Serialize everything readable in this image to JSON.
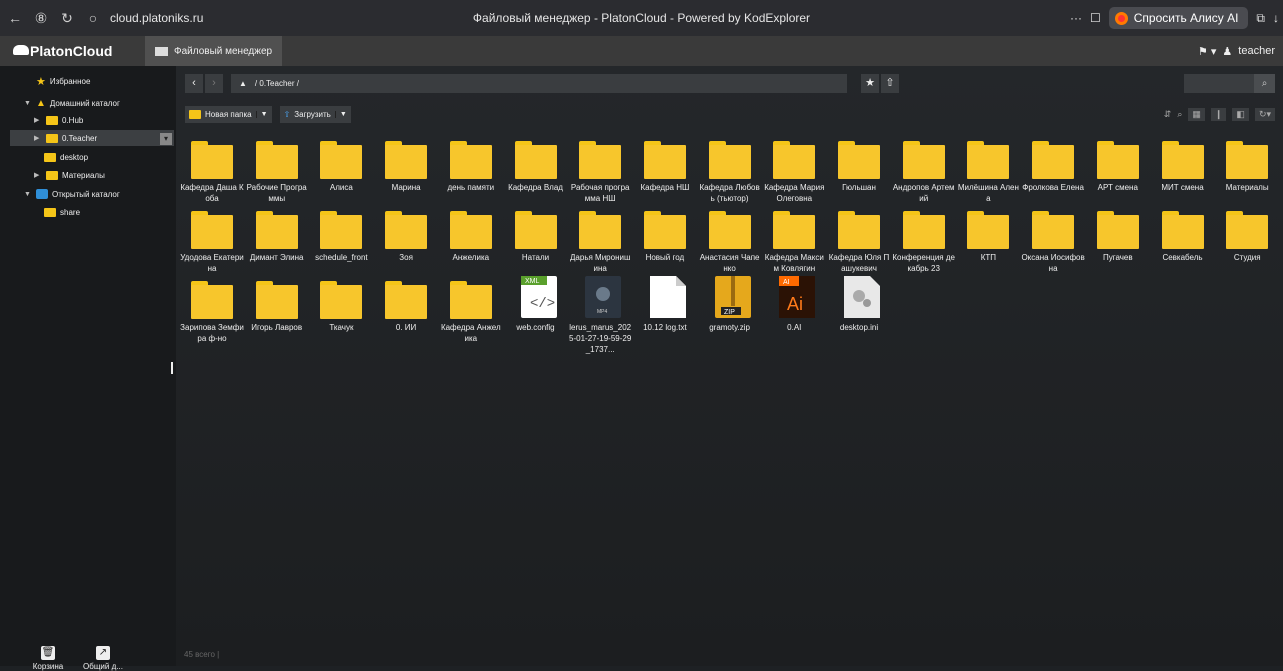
{
  "browser": {
    "url": "cloud.platoniks.ru",
    "title": "Файловый менеджер - PlatonCloud - Powered by KodExplorer",
    "alice": "Спросить Алису AI"
  },
  "header": {
    "logo": "PlatonCloud",
    "tab": "Файловый менеджер",
    "user": "teacher"
  },
  "sidebar": {
    "favorites": "Избранное",
    "home": "Домашний каталог",
    "hub": "0.Hub",
    "teacher": "0.Teacher",
    "desktop": "desktop",
    "materials": "Материалы",
    "public": "Открытый каталог",
    "share": "share",
    "trash": "Корзина",
    "shared": "Общий д..."
  },
  "toolbar": {
    "path": "/ 0.Teacher /",
    "new_folder": "Новая папка",
    "upload": "Загрузить"
  },
  "files": [
    {
      "name": "Кафедра Даша Коба",
      "type": "folder"
    },
    {
      "name": "Рабочие Программы",
      "type": "folder"
    },
    {
      "name": "Алиса",
      "type": "folder"
    },
    {
      "name": "Марина",
      "type": "folder"
    },
    {
      "name": "день памяти",
      "type": "folder"
    },
    {
      "name": "Кафедра Влад",
      "type": "folder"
    },
    {
      "name": "Рабочая программа НШ",
      "type": "folder"
    },
    {
      "name": "Кафедра НШ",
      "type": "folder"
    },
    {
      "name": "Кафедра Любовь (тьютор)",
      "type": "folder"
    },
    {
      "name": "Кафедра Мария Олеговна",
      "type": "folder"
    },
    {
      "name": "Гюльшан",
      "type": "folder"
    },
    {
      "name": "Андропов Артемий",
      "type": "folder"
    },
    {
      "name": "Милёшина Алена",
      "type": "folder"
    },
    {
      "name": "Фролкова Елена",
      "type": "folder"
    },
    {
      "name": "АРТ смена",
      "type": "folder"
    },
    {
      "name": "МИТ смена",
      "type": "folder"
    },
    {
      "name": "Материалы",
      "type": "folder"
    },
    {
      "name": "Удодова Екатерина",
      "type": "folder"
    },
    {
      "name": "Димант Элина",
      "type": "folder"
    },
    {
      "name": "schedule_front",
      "type": "folder"
    },
    {
      "name": "Зоя",
      "type": "folder"
    },
    {
      "name": "Анжелика",
      "type": "folder"
    },
    {
      "name": "Натали",
      "type": "folder"
    },
    {
      "name": "Дарья Миронишина",
      "type": "folder"
    },
    {
      "name": "Новый год",
      "type": "folder"
    },
    {
      "name": "Анастасия Чапенко",
      "type": "folder"
    },
    {
      "name": "Кафедра Максим Ковлягин",
      "type": "folder"
    },
    {
      "name": "Кафедра Юля Пашукевич",
      "type": "folder"
    },
    {
      "name": "Конференция декабрь 23",
      "type": "folder"
    },
    {
      "name": "КТП",
      "type": "folder"
    },
    {
      "name": "Оксана Иосифовна",
      "type": "folder"
    },
    {
      "name": "Пугачев",
      "type": "folder"
    },
    {
      "name": "Севкабель",
      "type": "folder"
    },
    {
      "name": "Студия",
      "type": "folder"
    },
    {
      "name": "Зарипова Земфира ф-но",
      "type": "folder"
    },
    {
      "name": "Игорь Лавров",
      "type": "folder"
    },
    {
      "name": "Ткачук",
      "type": "folder"
    },
    {
      "name": "0. ИИ",
      "type": "folder"
    },
    {
      "name": "Кафедра Анжелика",
      "type": "folder"
    },
    {
      "name": "web.config",
      "type": "xml"
    },
    {
      "name": "lerus_marus_2025-01-27-19-59-29_1737...",
      "type": "mp4"
    },
    {
      "name": "10.12 log.txt",
      "type": "txt"
    },
    {
      "name": "gramoty.zip",
      "type": "zip"
    },
    {
      "name": "0.AI",
      "type": "ai"
    },
    {
      "name": "desktop.ini",
      "type": "ini"
    }
  ],
  "status": "45 всего |"
}
